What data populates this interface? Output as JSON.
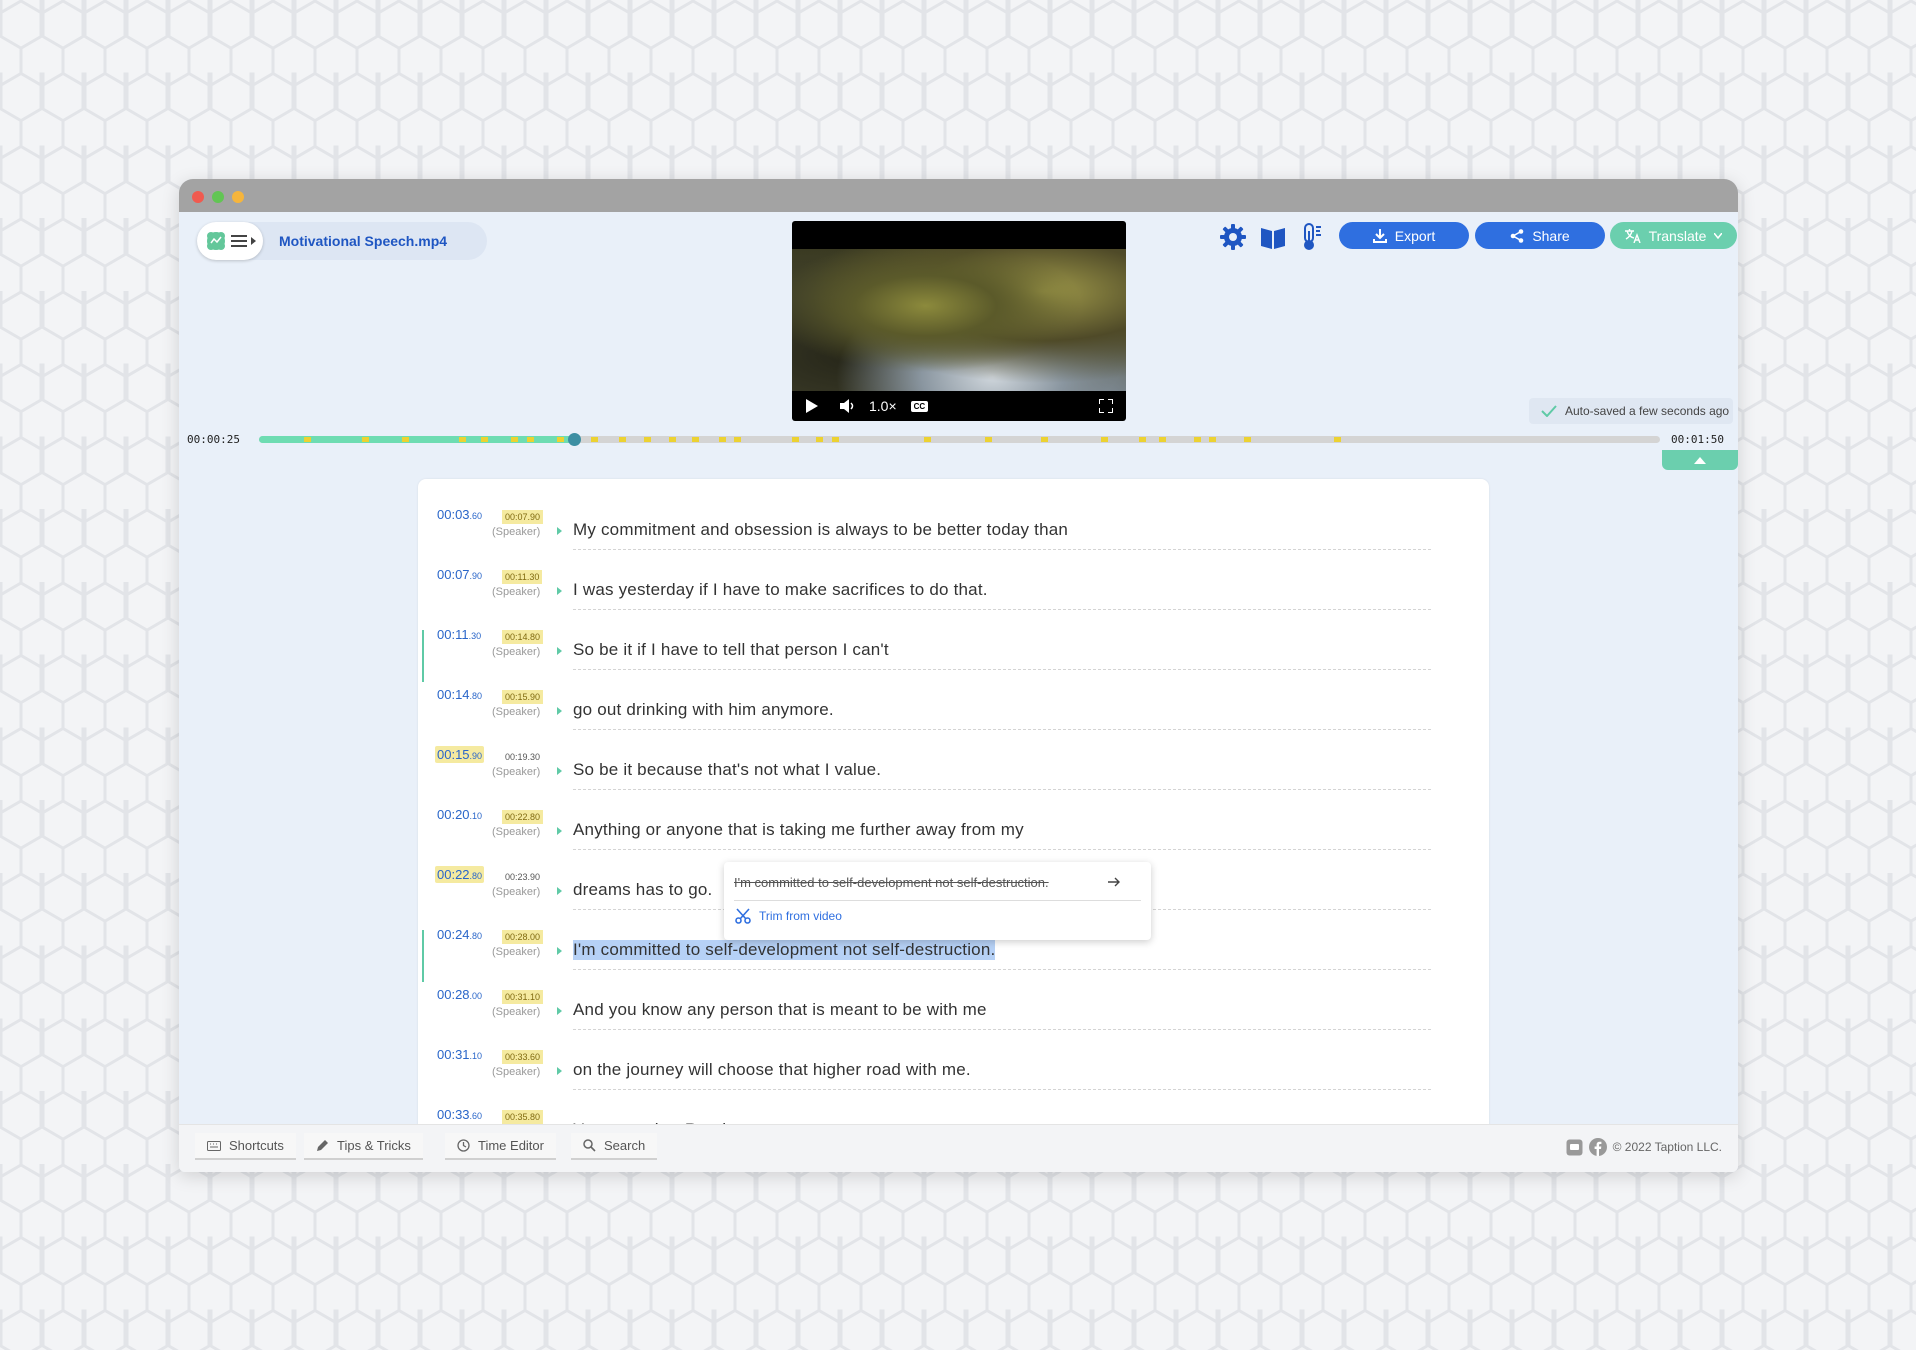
{
  "file": {
    "name": "Motivational Speech.mp4"
  },
  "video": {
    "speed": "1.0×",
    "cc": "CC"
  },
  "toolbar": {
    "export_label": "Export",
    "share_label": "Share",
    "translate_label": "Translate"
  },
  "status": {
    "autosave": "Auto-saved a few seconds ago"
  },
  "timeline": {
    "current": "00:00:25",
    "total": "00:01:50",
    "progress_fraction": 0.225
  },
  "colors": {
    "accent": "#2f6fe0",
    "teal": "#6edcb2",
    "highlight": "#ecd232",
    "selection": "#b6d1f6"
  },
  "rows": [
    {
      "start": "00:03",
      "start_ms": ".60",
      "end": "00:07.90",
      "speaker": "(Speaker)",
      "text": "My commitment and obsession is always to be better today than"
    },
    {
      "start": "00:07",
      "start_ms": ".90",
      "end": "00:11.30",
      "speaker": "(Speaker)",
      "text": "I was yesterday if I have to make sacrifices to do that."
    },
    {
      "start": "00:11",
      "start_ms": ".30",
      "end": "00:14.80",
      "speaker": "(Speaker)",
      "text": "So be it if I have to tell that person I can't"
    },
    {
      "start": "00:14",
      "start_ms": ".80",
      "end": "00:15.90",
      "speaker": "(Speaker)",
      "text": "go out drinking with him anymore."
    },
    {
      "start": "00:15",
      "start_ms": ".90",
      "end": "00:19.30",
      "speaker": "(Speaker)",
      "text": "So be it because that's not what I value."
    },
    {
      "start": "00:20",
      "start_ms": ".10",
      "end": "00:22.80",
      "speaker": "(Speaker)",
      "text": "Anything or anyone that is taking me further away from my"
    },
    {
      "start": "00:22",
      "start_ms": ".80",
      "end": "00:23.90",
      "speaker": "(Speaker)",
      "text": "dreams has to go."
    },
    {
      "start": "00:24",
      "start_ms": ".80",
      "end": "00:28.00",
      "speaker": "(Speaker)",
      "text": "I'm committed to self-development not self-destruction."
    },
    {
      "start": "00:28",
      "start_ms": ".00",
      "end": "00:31.10",
      "speaker": "(Speaker)",
      "text": "And you know any person that is meant to be with me"
    },
    {
      "start": "00:31",
      "start_ms": ".10",
      "end": "00:33.60",
      "speaker": "(Speaker)",
      "text": "on the journey will choose that higher road with me."
    },
    {
      "start": "00:33",
      "start_ms": ".60",
      "end": "00:35.80",
      "speaker": "(Speaker)",
      "text": "Yes a tougher Road."
    }
  ],
  "popup": {
    "strike_text": "I'm committed to self-development not self-destruction.",
    "trim_label": "Trim from video"
  },
  "footer": {
    "shortcuts": "Shortcuts",
    "tips": "Tips & Tricks",
    "time_editor": "Time Editor",
    "search": "Search",
    "copyright": "© 2022 Taption LLC."
  }
}
